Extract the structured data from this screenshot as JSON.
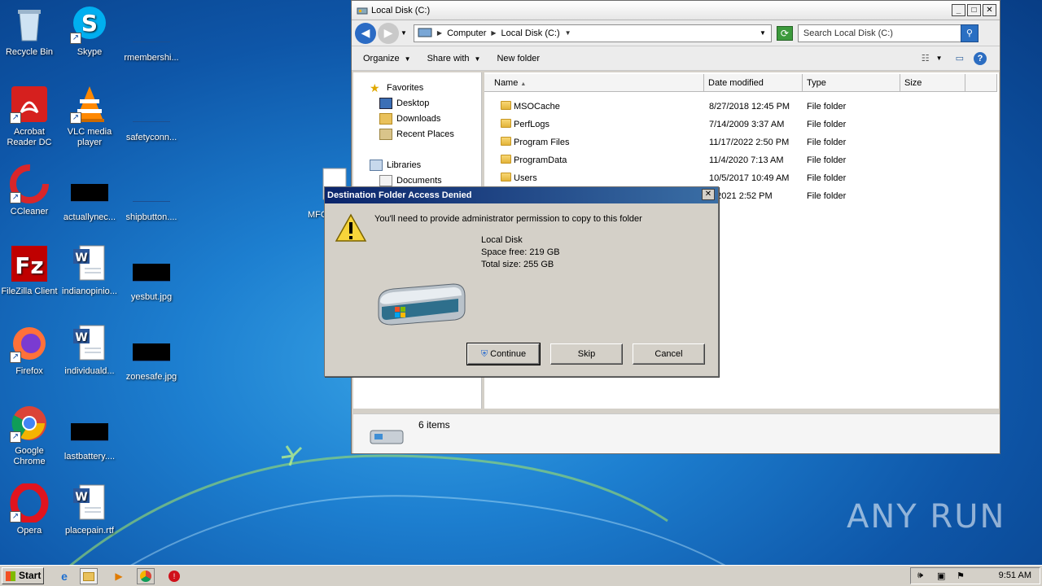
{
  "desktop": {
    "icons": [
      {
        "label": "Recycle Bin"
      },
      {
        "label": "Skype"
      },
      {
        "label": "rmembershi..."
      },
      {
        "label": "Acrobat Reader DC"
      },
      {
        "label": "VLC media player"
      },
      {
        "label": "safetyconn..."
      },
      {
        "label": "CCleaner"
      },
      {
        "label": "actuallynec..."
      },
      {
        "label": "shipbutton...."
      },
      {
        "label": "FileZilla Client"
      },
      {
        "label": "indianopinio..."
      },
      {
        "label": "yesbut.jpg"
      },
      {
        "label": "Firefox"
      },
      {
        "label": "individuald..."
      },
      {
        "label": "zonesafe.jpg"
      },
      {
        "label": "Google Chrome"
      },
      {
        "label": "lastbattery...."
      },
      {
        "label": "Opera"
      },
      {
        "label": "placepain.rtf"
      },
      {
        "label": "MFC"
      }
    ]
  },
  "explorer": {
    "title": "Local Disk (C:)",
    "breadcrumb": [
      "Computer",
      "Local Disk (C:)"
    ],
    "search_placeholder": "Search Local Disk (C:)",
    "toolbar": {
      "organize": "Organize",
      "share_with": "Share with",
      "new_folder": "New folder"
    },
    "nav": {
      "favorites": "Favorites",
      "desktop": "Desktop",
      "downloads": "Downloads",
      "recent": "Recent Places",
      "libraries": "Libraries",
      "documents": "Documents"
    },
    "columns": {
      "name": "Name",
      "date": "Date modified",
      "type": "Type",
      "size": "Size"
    },
    "files": [
      {
        "name": "MSOCache",
        "date": "8/27/2018 12:45 PM",
        "type": "File folder"
      },
      {
        "name": "PerfLogs",
        "date": "7/14/2009 3:37 AM",
        "type": "File folder"
      },
      {
        "name": "Program Files",
        "date": "11/17/2022 2:50 PM",
        "type": "File folder"
      },
      {
        "name": "ProgramData",
        "date": "11/4/2020 7:13 AM",
        "type": "File folder"
      },
      {
        "name": "Users",
        "date": "10/5/2017 10:49 AM",
        "type": "File folder"
      },
      {
        "name": "",
        "date": "1/2021 2:52 PM",
        "type": "File folder"
      }
    ],
    "status": "6 items"
  },
  "dialog": {
    "title": "Destination Folder Access Denied",
    "message": "You'll need to provide administrator permission to copy to this folder",
    "drive_name": "Local Disk",
    "space_free": "Space free: 219 GB",
    "total_size": "Total size: 255 GB",
    "buttons": {
      "continue": "Continue",
      "skip": "Skip",
      "cancel": "Cancel"
    }
  },
  "taskbar": {
    "start": "Start",
    "clock": "9:51 AM"
  },
  "watermark": "ANY RUN"
}
